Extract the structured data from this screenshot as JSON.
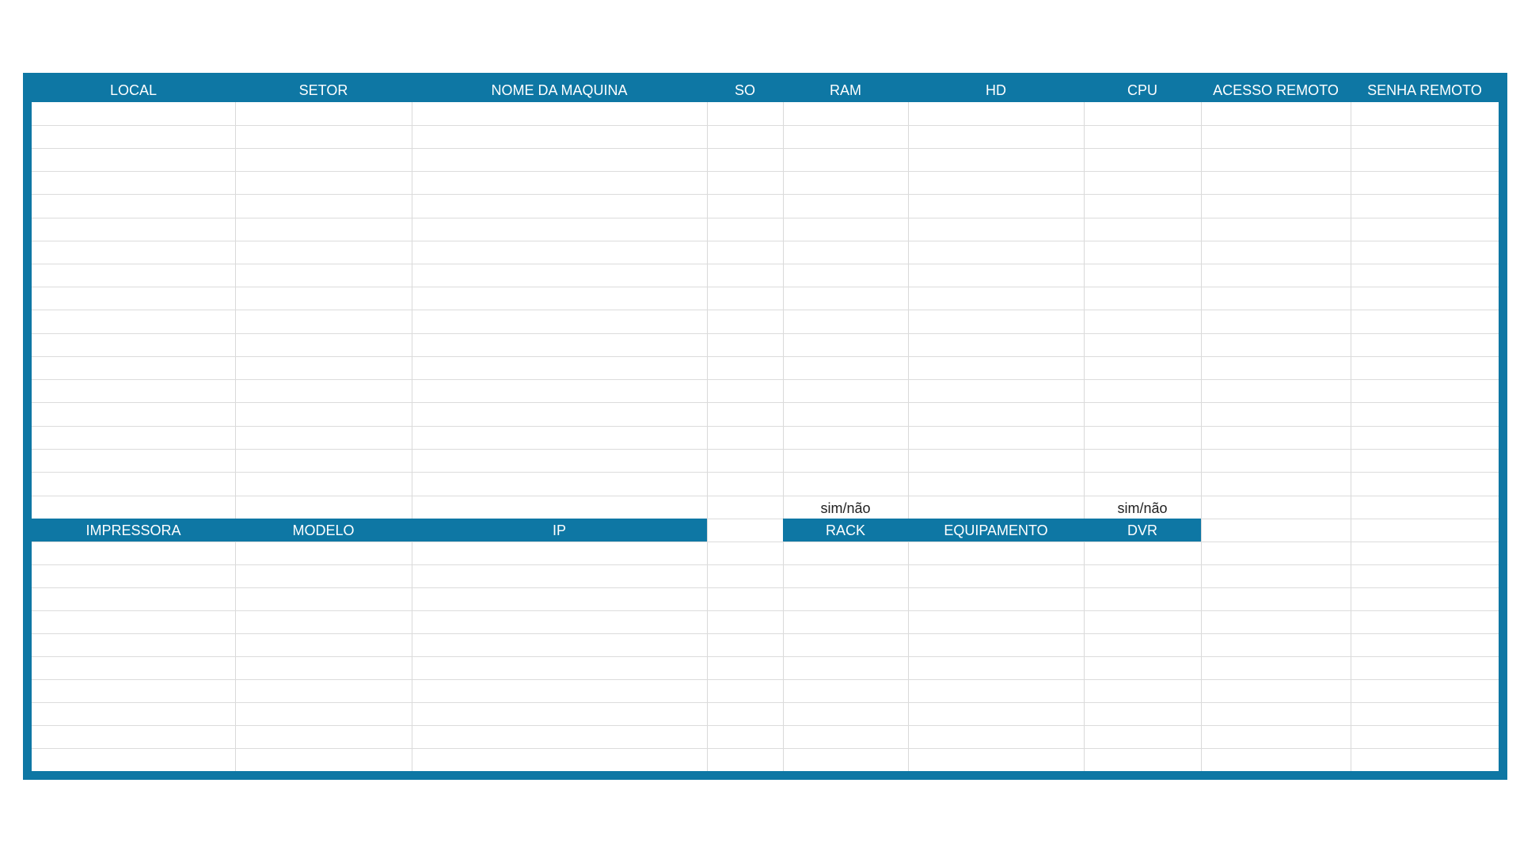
{
  "colors": {
    "header_bg": "#0e77a4",
    "header_text": "#ffffff",
    "grid_line": "#dcdcdc",
    "cell_bg": "#ffffff"
  },
  "main_table": {
    "columns": [
      "LOCAL",
      "SETOR",
      "NOME DA MAQUINA",
      "SO",
      "RAM",
      "HD",
      "CPU",
      "ACESSO REMOTO",
      "SENHA REMOTO"
    ]
  },
  "notes": {
    "ram_hint": "sim/não",
    "cpu_hint": "sim/não"
  },
  "printer_table": {
    "columns": [
      "IMPRESSORA",
      "MODELO",
      "IP"
    ]
  },
  "equipment_table": {
    "columns": [
      "RACK",
      "EQUIPAMENTO",
      "DVR"
    ]
  }
}
